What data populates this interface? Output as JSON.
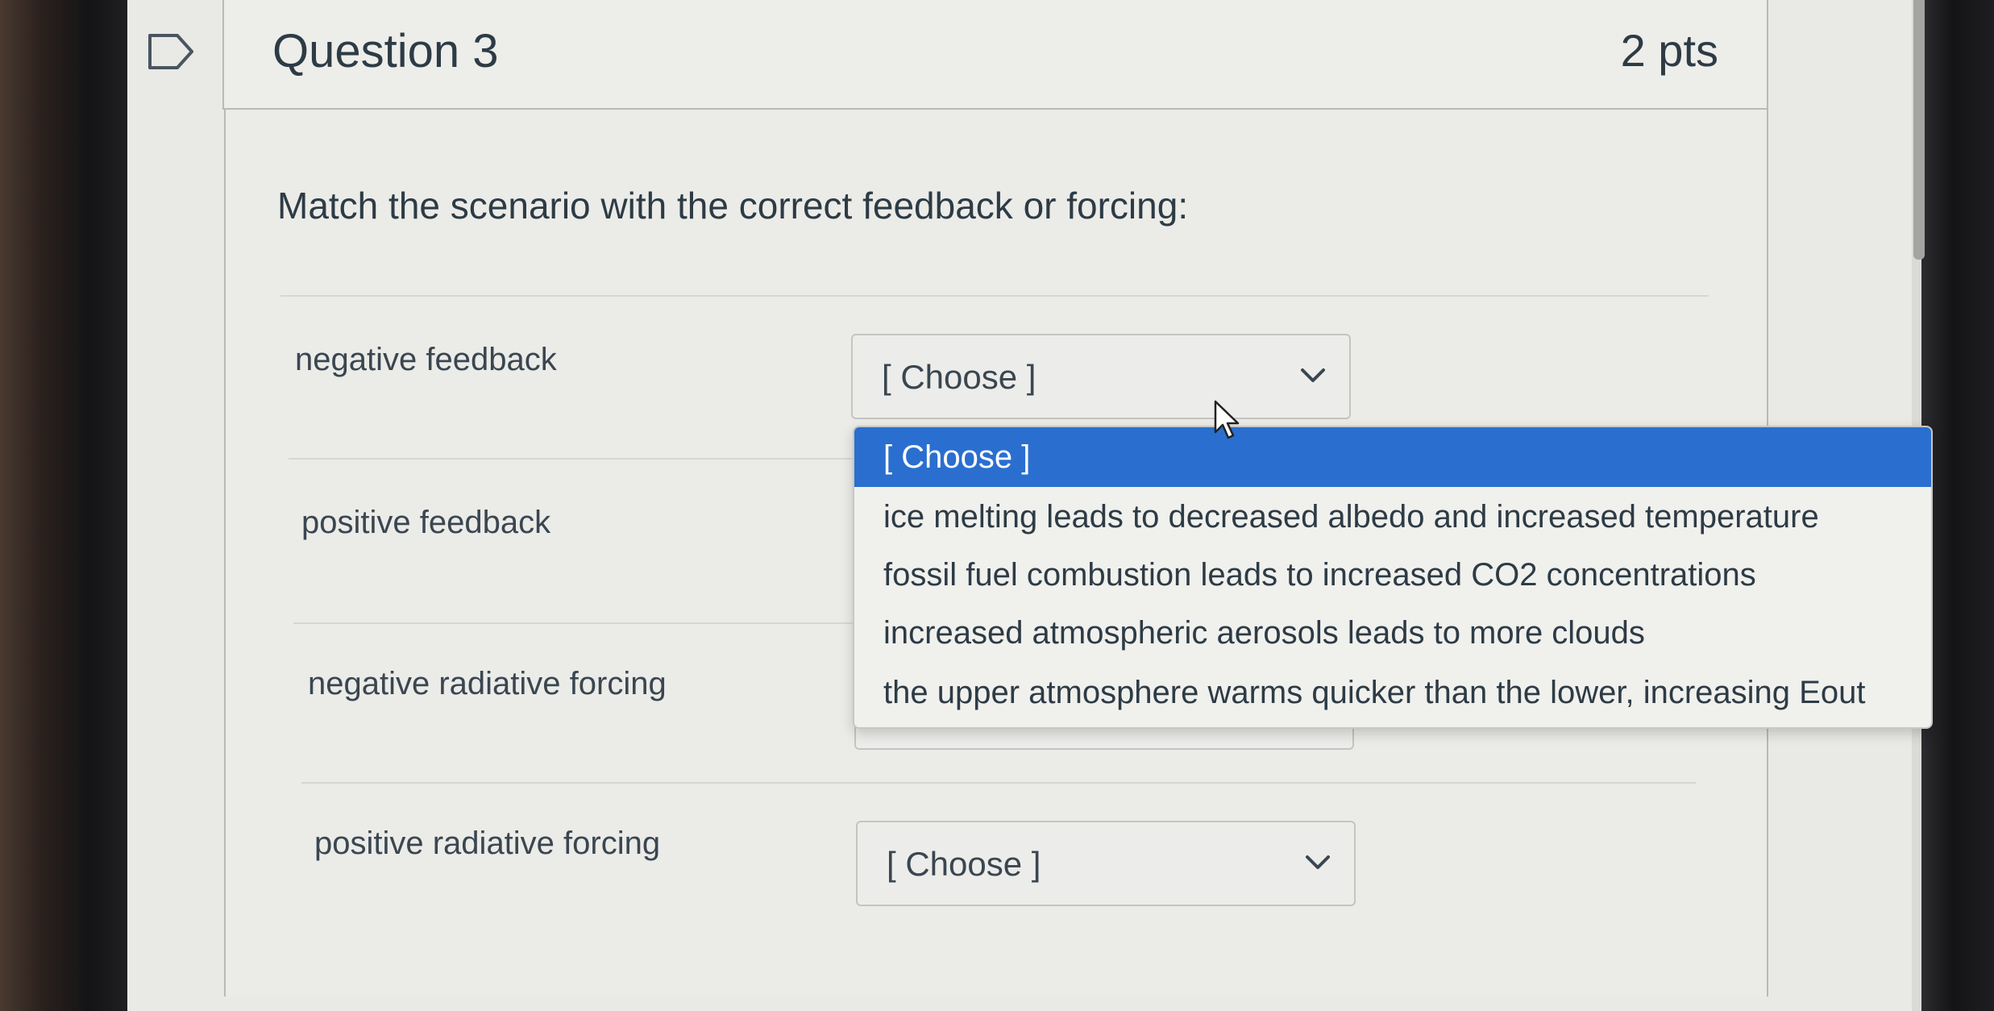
{
  "question": {
    "title": "Question 3",
    "points": "2 pts",
    "prompt": "Match the scenario with the correct feedback or forcing:"
  },
  "matches": [
    {
      "label": "negative feedback",
      "selected": "[ Choose ]"
    },
    {
      "label": "positive feedback",
      "selected": "[ Choose ]"
    },
    {
      "label": "negative radiative forcing",
      "selected": "[ Choose ]"
    },
    {
      "label": "positive radiative forcing",
      "selected": "[ Choose ]"
    }
  ],
  "dropdown": {
    "options": [
      "[ Choose ]",
      "ice melting leads to decreased albedo and increased temperature",
      "fossil fuel combustion leads to increased CO2 concentrations",
      "increased atmospheric aerosols leads to more clouds",
      "the upper atmosphere warms quicker than the lower, increasing Eout"
    ],
    "highlighted_index": 0
  },
  "icons": {
    "flag": "flag-outline-icon",
    "chevron": "chevron-down-icon",
    "cursor": "mouse-pointer-icon"
  },
  "colors": {
    "highlight": "#2a6fcf",
    "text": "#2d3b45"
  }
}
